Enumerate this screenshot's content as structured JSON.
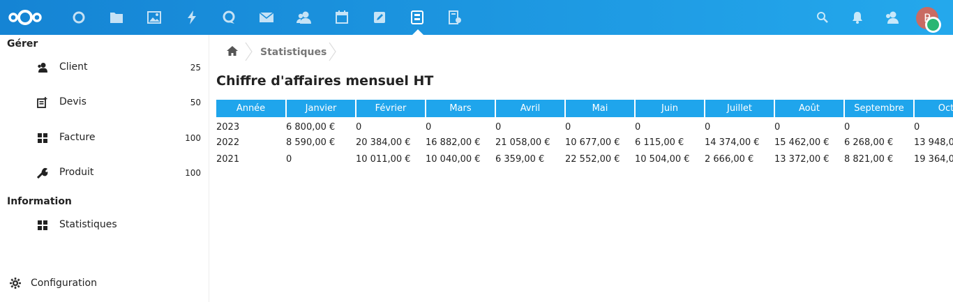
{
  "topbar": {
    "accent": "#1fa1e6",
    "apps": [
      {
        "icon": "nextcloud-logo"
      },
      {
        "icon": "dashboard-icon"
      },
      {
        "icon": "files-icon"
      },
      {
        "icon": "photos-icon"
      },
      {
        "icon": "activity-icon"
      },
      {
        "icon": "talk-icon"
      },
      {
        "icon": "mail-icon"
      },
      {
        "icon": "contacts-icon"
      },
      {
        "icon": "calendar-icon"
      },
      {
        "icon": "notes-icon"
      },
      {
        "icon": "gestion-icon",
        "active": true
      },
      {
        "icon": "deck-icon"
      }
    ],
    "right": {
      "search": "search-icon",
      "notifications": "bell-icon",
      "contacts": "contacts-menu-icon"
    },
    "avatar": {
      "initial": "P",
      "color": "#c96b63",
      "status_color": "#2ab673"
    }
  },
  "sidebar": {
    "section1": "Gérer",
    "items": [
      {
        "label": "Client",
        "count": "25",
        "icon": "client-icon"
      },
      {
        "label": "Devis",
        "count": "50",
        "icon": "quote-icon"
      },
      {
        "label": "Facture",
        "count": "100",
        "icon": "grid-icon"
      },
      {
        "label": "Produit",
        "count": "100",
        "icon": "wrench-icon"
      }
    ],
    "section2": "Information",
    "info_items": [
      {
        "label": "Statistiques",
        "icon": "grid-icon"
      }
    ],
    "configuration": "Configuration"
  },
  "breadcrumb": {
    "home": "home-icon",
    "current": "Statistiques"
  },
  "main": {
    "title": "Chiffre d'affaires mensuel HT",
    "table": {
      "headers": [
        "Année",
        "Janvier",
        "Février",
        "Mars",
        "Avril",
        "Mai",
        "Juin",
        "Juillet",
        "Août",
        "Septembre",
        "Octo"
      ],
      "rows": [
        [
          "2023",
          "6 800,00 €",
          "0",
          "0",
          "0",
          "0",
          "0",
          "0",
          "0",
          "0",
          "0"
        ],
        [
          "2022",
          "8 590,00 €",
          "20 384,00 €",
          "16 882,00 €",
          "21 058,00 €",
          "10 677,00 €",
          "6 115,00 €",
          "14 374,00 €",
          "15 462,00 €",
          "6 268,00 €",
          "13 948,0"
        ],
        [
          "2021",
          "0",
          "10 011,00 €",
          "10 040,00 €",
          "6 359,00 €",
          "22 552,00 €",
          "10 504,00 €",
          "2 666,00 €",
          "13 372,00 €",
          "8 821,00 €",
          "19 364,0"
        ]
      ]
    }
  }
}
